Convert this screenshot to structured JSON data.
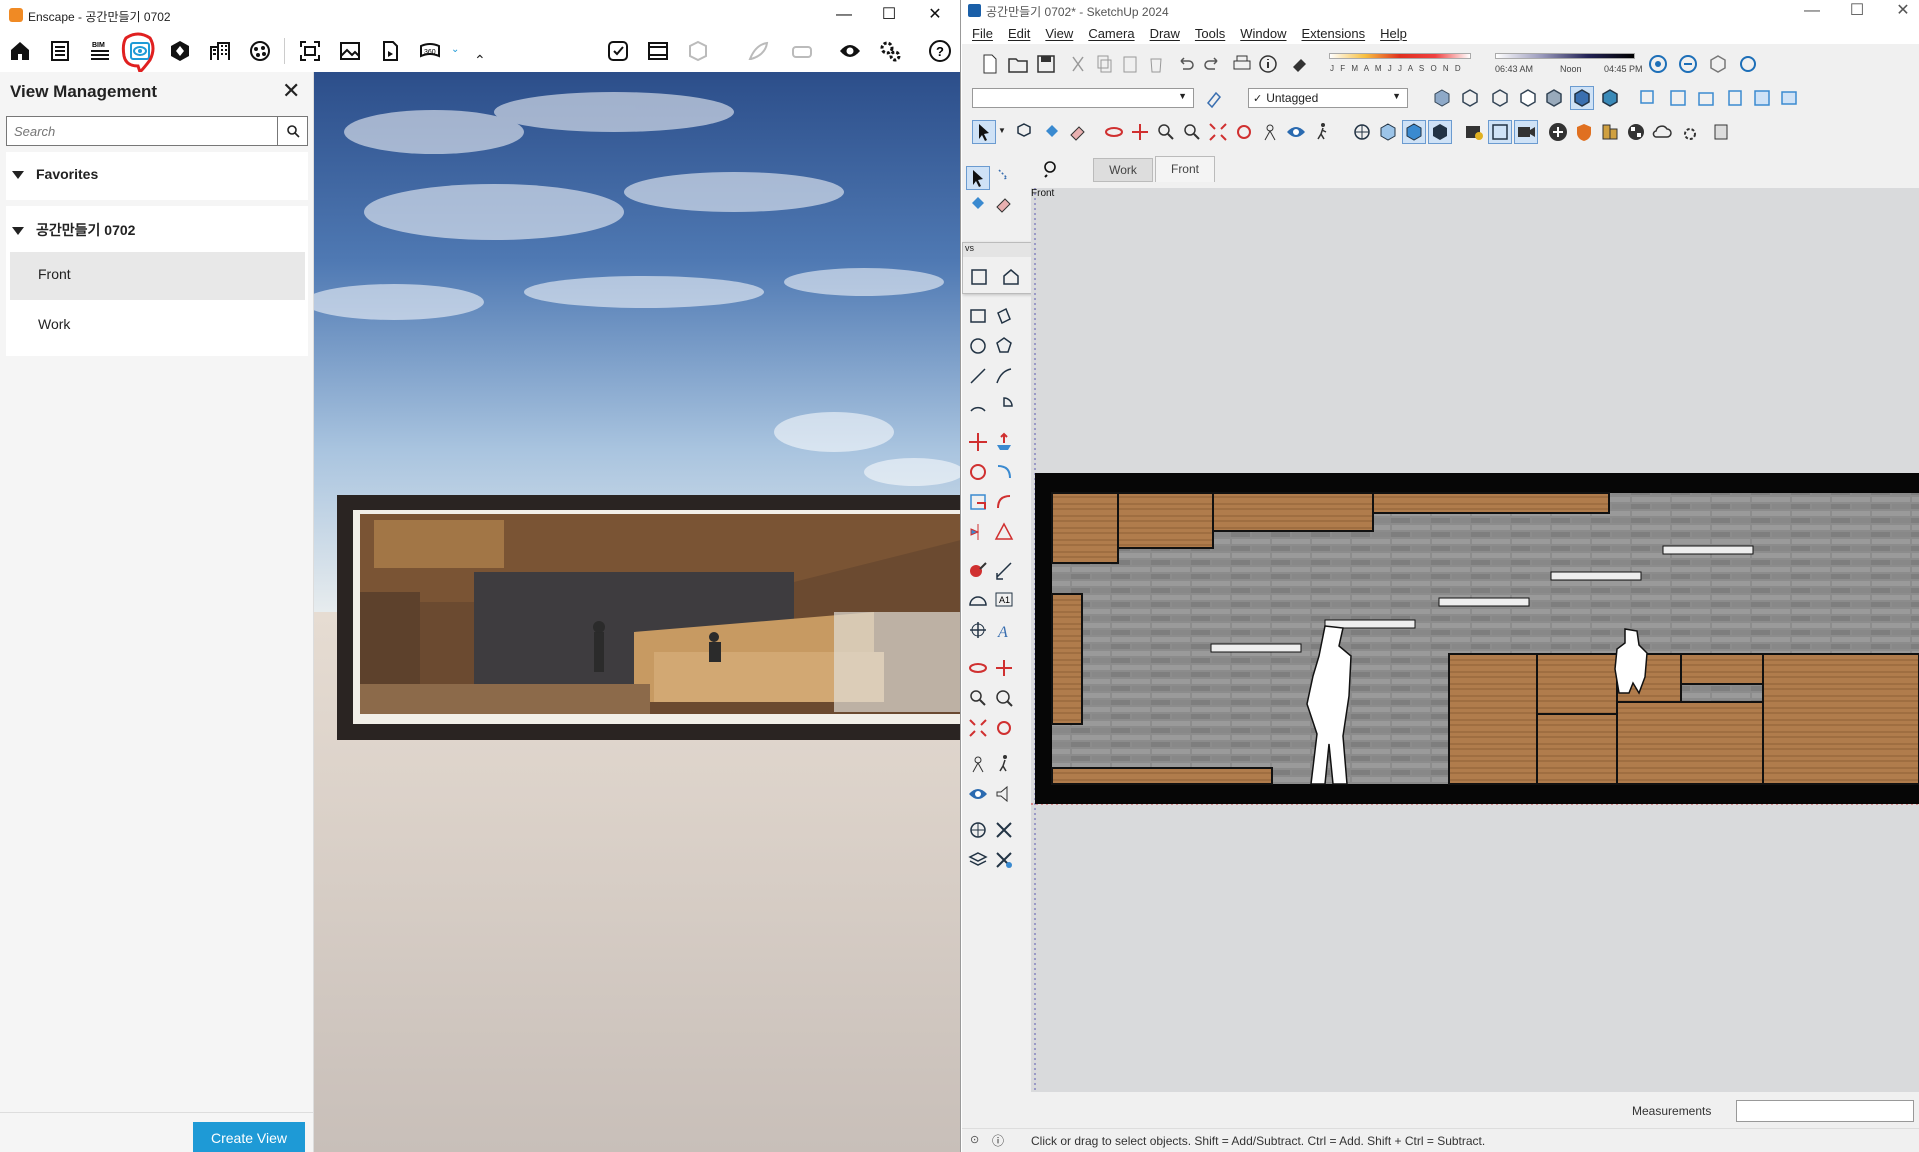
{
  "enscape": {
    "title": "Enscape - 공간만들기 0702",
    "window_controls": [
      "—",
      "☐",
      "✕"
    ],
    "toolbar": {
      "icons": [
        "home-icon",
        "document-icon",
        "bim-icon",
        "view-management-icon",
        "asset-library-icon",
        "buildings-icon",
        "material-icon",
        "screenshot-icon",
        "image-icon",
        "export-icon",
        "panorama-icon",
        "collapse-icon",
        "uncheck-icon",
        "batch-render-icon",
        "section-cube-icon",
        "feather-icon",
        "vr-headset-icon",
        "eye-icon",
        "settings-icon",
        "help-icon"
      ],
      "bim_label": "BIM"
    },
    "view_management": {
      "heading": "View Management",
      "search_placeholder": "Search",
      "favorites_label": "Favorites",
      "project_label": "공간만들기 0702",
      "views": [
        "Front",
        "Work"
      ],
      "selected_view": "Front",
      "create_button": "Create View"
    },
    "accent": "#1e9ad6"
  },
  "sketchup": {
    "title": "공간만들기 0702* - SketchUp 2024",
    "window_controls": [
      "—",
      "☐",
      "✕"
    ],
    "menu": [
      "File",
      "Edit",
      "View",
      "Camera",
      "Draw",
      "Tools",
      "Window",
      "Extensions",
      "Help"
    ],
    "shadow_months": "J F M A M J J A S O N D",
    "shadow_times": {
      "start": "06:43 AM",
      "mid": "Noon",
      "end": "04:45 PM"
    },
    "tag_dropdown": "Untagged",
    "scene_tabs": [
      "Work",
      "Front"
    ],
    "views_panel_title": "vs",
    "active_scene_label": "Front",
    "measurements_label": "Measurements",
    "status_text": "Click or drag to select objects. Shift = Add/Subtract. Ctrl = Add. Shift + Ctrl = Subtract."
  }
}
